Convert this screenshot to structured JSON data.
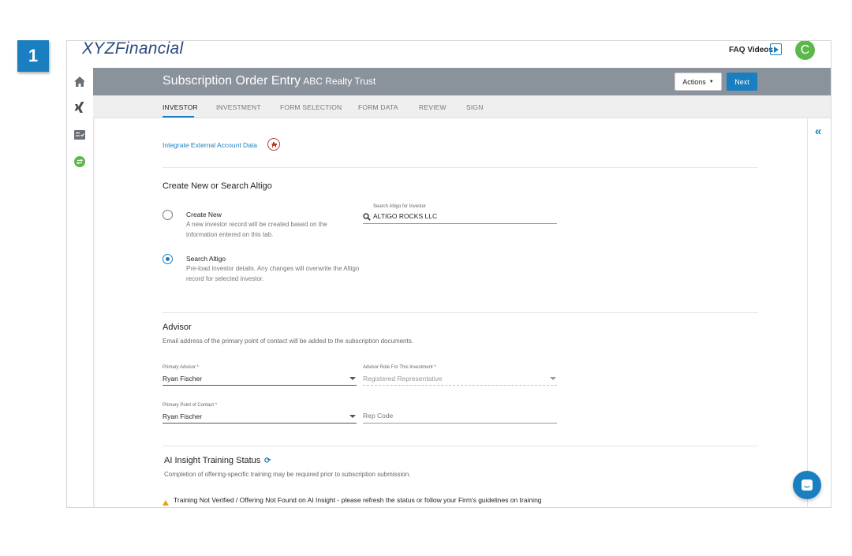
{
  "step": {
    "number": "1"
  },
  "brand": {
    "prefix": "XYZ",
    "suffix": "Financial"
  },
  "topbar": {
    "faq_label": "FAQ Videos",
    "avatar_initial": "C"
  },
  "header": {
    "title": "Subscription Order Entry",
    "subtitle": "ABC Realty Trust",
    "actions_label": "Actions",
    "next_label": "Next"
  },
  "tabs": [
    {
      "label": "INVESTOR",
      "active": true
    },
    {
      "label": "INVESTMENT",
      "active": false
    },
    {
      "label": "FORM SELECTION",
      "active": false
    },
    {
      "label": "FORM DATA",
      "active": false
    },
    {
      "label": "REVIEW",
      "active": false
    },
    {
      "label": "SIGN",
      "active": false
    }
  ],
  "integrate": {
    "link_label": "Integrate External Account Data"
  },
  "create_search": {
    "title": "Create New or Search Altigo",
    "create_new": {
      "label": "Create New",
      "description": "A new investor record will be created based on the information entered on this tab.",
      "selected": false
    },
    "search_altigo": {
      "label": "Search Altigo",
      "description": "Pre-load investor details. Any changes will overwrite the Altigo record for selected investor.",
      "selected": true
    },
    "search_field": {
      "label": "Search Altigo for Investor",
      "value": "ALTIGO ROCKS LLC"
    }
  },
  "advisor": {
    "title": "Advisor",
    "description": "Email address of the primary point of contact will be added to the subscription documents.",
    "primary_advisor": {
      "label": "Primary Advisor *",
      "value": "Ryan Fischer"
    },
    "advisor_role": {
      "label": "Advisor Role For This Investment *",
      "value": "Registered Representative"
    },
    "primary_contact": {
      "label": "Primary Point of Contact *",
      "value": "Ryan Fischer"
    },
    "rep_code": {
      "placeholder": "Rep Code"
    }
  },
  "ai_insight": {
    "title": "AI Insight Training Status",
    "description": "Completion of offering-specific training may be required prior to subscription submission.",
    "warning": "Training Not Verified / Offering Not Found on AI Insight - please refresh the status or follow your Firm's guidelines on training compliance prior to submitting a subscription for this offering."
  },
  "colors": {
    "accent": "#1a7fc0",
    "header_bg": "#8a929b",
    "avatar": "#5db84a",
    "warning": "#e3a21a"
  }
}
